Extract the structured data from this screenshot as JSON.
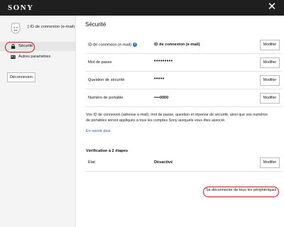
{
  "header": {
    "brand": "SONY",
    "close_icon": "close-icon"
  },
  "sidebar": {
    "account_label": "[ ID de connexion (e-mail) ]",
    "avatar_icon": "smiley-avatar-icon",
    "items": [
      {
        "label": "Sécurité",
        "icon": "lock-icon",
        "active": true
      },
      {
        "label": "Autres paramètres",
        "icon": "id-card-icon",
        "active": false
      }
    ],
    "logout_label": "Déconnexion"
  },
  "main": {
    "title": "Sécurité",
    "rows": [
      {
        "label": "ID de connexion (e-mail)",
        "value": "ID de connexion (e-mail)",
        "button": "Modifier",
        "has_help": true
      },
      {
        "label": "Mot de passe",
        "value": "•••••••••",
        "button": "Modifier"
      },
      {
        "label": "Question de sécurité",
        "value": "•••••",
        "button": "Modifier"
      },
      {
        "label": "Numéro de portable",
        "value": "••••0000",
        "button": "Modifier"
      }
    ],
    "info_text": "Vos ID de connexion (adresse e-mail), mot de passe, question et réponse de sécurité, ainsi que vos numéros de portables seront appliqués à tous les comptes Sony auxquels vous êtes associé.",
    "more_link": "En savoir plus",
    "two_step_title": "Vérification à 2 étapes",
    "two_step_row": {
      "label": "État",
      "value": "Désactivé",
      "button": "Modifier"
    },
    "logout_all": "Se déconnecter de tous les périphériques"
  },
  "colors": {
    "accent_link": "#2d62b5",
    "highlight": "#c0161b",
    "header_bg": "#1f1f1f"
  }
}
